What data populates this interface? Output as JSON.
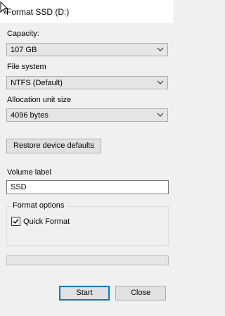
{
  "window": {
    "title": "Format SSD (D:)"
  },
  "capacity": {
    "label": "Capacity:",
    "value": "107 GB"
  },
  "file_system": {
    "label": "File system",
    "value": "NTFS (Default)"
  },
  "allocation_unit": {
    "label": "Allocation unit size",
    "value": "4096 bytes"
  },
  "restore_defaults_label": "Restore device defaults",
  "volume": {
    "label": "Volume label",
    "value": "SSD"
  },
  "format_options": {
    "title": "Format options",
    "quick_format_label": "Quick Format",
    "quick_format_checked": true
  },
  "progress": {
    "fraction": 0
  },
  "buttons": {
    "start_label": "Start",
    "close_label": "Close"
  },
  "colors": {
    "accent": "#0078d7",
    "background": "#f0f0f0",
    "progress_fill": "#06b025"
  },
  "icons": {
    "pointer": "mouse-cursor-icon",
    "dropdown": "chevron-down-icon",
    "check": "checkmark-icon"
  }
}
